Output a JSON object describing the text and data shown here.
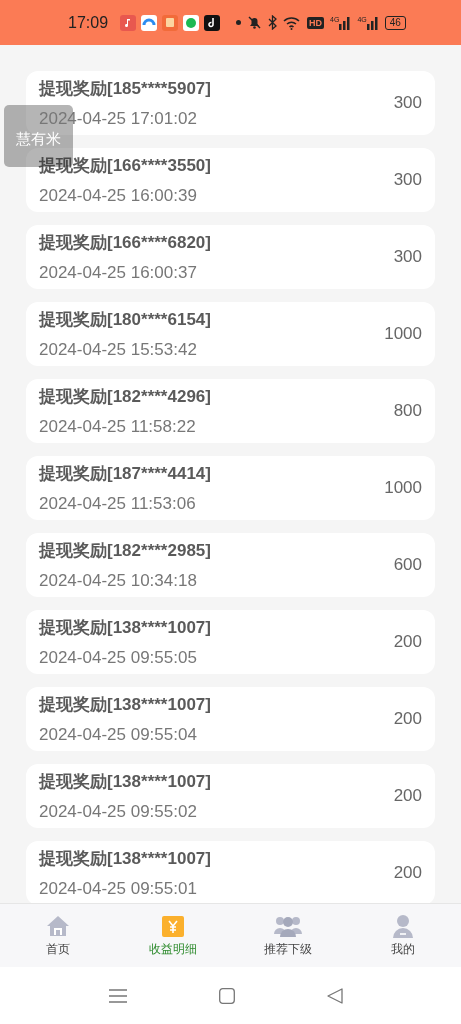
{
  "status_bar": {
    "time": "17:09",
    "hd_badge": "HD",
    "networks": [
      "4G",
      "4G"
    ],
    "battery": "46"
  },
  "records": [
    {
      "title": "提现奖励[185****5907]",
      "time": "2024-04-25 17:01:02",
      "amount": "300"
    },
    {
      "title": "提现奖励[166****3550]",
      "time": "2024-04-25 16:00:39",
      "amount": "300"
    },
    {
      "title": "提现奖励[166****6820]",
      "time": "2024-04-25 16:00:37",
      "amount": "300"
    },
    {
      "title": "提现奖励[180****6154]",
      "time": "2024-04-25 15:53:42",
      "amount": "1000"
    },
    {
      "title": "提现奖励[182****4296]",
      "time": "2024-04-25 11:58:22",
      "amount": "800"
    },
    {
      "title": "提现奖励[187****4414]",
      "time": "2024-04-25 11:53:06",
      "amount": "1000"
    },
    {
      "title": "提现奖励[182****2985]",
      "time": "2024-04-25 10:34:18",
      "amount": "600"
    },
    {
      "title": "提现奖励[138****1007]",
      "time": "2024-04-25 09:55:05",
      "amount": "200"
    },
    {
      "title": "提现奖励[138****1007]",
      "time": "2024-04-25 09:55:04",
      "amount": "200"
    },
    {
      "title": "提现奖励[138****1007]",
      "time": "2024-04-25 09:55:02",
      "amount": "200"
    },
    {
      "title": "提现奖励[138****1007]",
      "time": "2024-04-25 09:55:01",
      "amount": "200"
    }
  ],
  "toast": "慧有米",
  "tabs": [
    {
      "label": "首页",
      "kind": "home",
      "selected": false
    },
    {
      "label": "收益明细",
      "kind": "wallet",
      "selected": true
    },
    {
      "label": "推荐下级",
      "kind": "group",
      "selected": false
    },
    {
      "label": "我的",
      "kind": "user",
      "selected": false
    }
  ]
}
